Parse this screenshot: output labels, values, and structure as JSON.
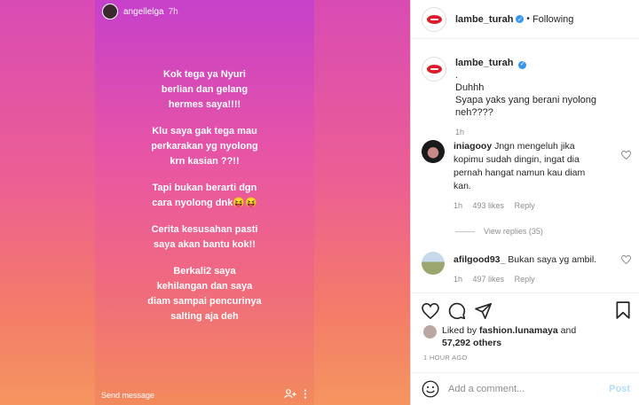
{
  "story": {
    "username": "angellelga",
    "time": "7h",
    "paragraphs": [
      "Kok tega ya Nyuri\nberlian dan gelang\nhermes saya!!!!",
      "Klu saya gak tega mau\nperkarakan yg nyolong\nkrn kasian ??!!",
      "Tapi bukan berarti dgn\ncara nyolong dnk😝😝",
      "Cerita kesusahan pasti\nsaya akan bantu kok!!",
      "Berkali2 saya\nkehilangan dan saya\ndiam sampai pencurinya\nsalting aja deh"
    ],
    "send_message": "Send message"
  },
  "post": {
    "username": "lambe_turah",
    "following_label": "Following",
    "separator": "•",
    "caption": {
      "username": "lambe_turah",
      "lines": [
        ".",
        "Duhhh",
        "Syapa yaks yang berani nyolong",
        "neh????"
      ],
      "time": "1h"
    },
    "comments": [
      {
        "username": "iniagooy",
        "text": "Jngn mengeluh jika kopimu sudah dingin, ingat dia pernah hangat namun kau diam kan.",
        "time": "1h",
        "likes": "493 likes",
        "reply": "Reply"
      },
      {
        "username": "afilgood93_",
        "text": "Bukan saya yg ambil.",
        "time": "1h",
        "likes": "497 likes",
        "reply": "Reply"
      }
    ],
    "view_replies": "View replies (35)",
    "liked_by_prefix": "Liked by",
    "liked_by_user": "fashion.lunamaya",
    "liked_by_and": "and",
    "liked_by_others": "57,292 others",
    "time_ago": "1 HOUR AGO",
    "add_comment_placeholder": "Add a comment...",
    "post_button": "Post"
  },
  "colors": {
    "verified": "#3897f0",
    "post_button": "#b2dffc",
    "brand_lips": "#d81e2a"
  }
}
